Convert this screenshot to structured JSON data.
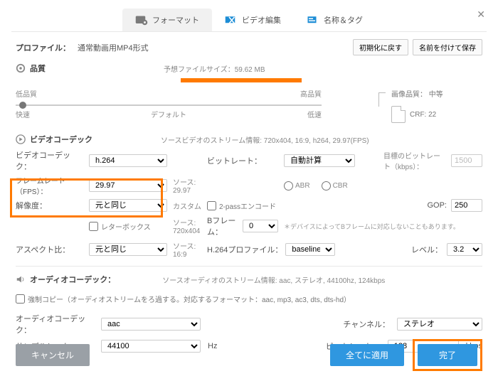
{
  "tabs": {
    "format": "フォーマット",
    "edit": "ビデオ編集",
    "tag": "名称＆タグ"
  },
  "profile": {
    "label": "プロファイル：",
    "value": "通常動画用MP4形式"
  },
  "buttons": {
    "reset": "初期化に戻す",
    "saveas": "名前を付けて保存",
    "cancel": "キャンセル",
    "apply": "全てに適用",
    "done": "完了"
  },
  "quality": {
    "title": "品質",
    "est_label": "予想ファイルサイズ：",
    "est_value": "59.62 MB",
    "low": "低品質",
    "high": "高品質",
    "fast": "快速",
    "default": "デフォルト",
    "slow": "低速",
    "pic_q_label": "画像品質：",
    "pic_q_value": "中等",
    "crf_label": "CRF:",
    "crf_value": "22"
  },
  "video": {
    "title": "ビデオコーデック",
    "stream": "ソースビデオのストリーム情報: 720x404, 16:9, h264, 29.97(FPS)",
    "codec_label": "ビデオコーデック：",
    "codec_value": "h.264",
    "bitrate_label": "ビットレート：",
    "bitrate_value": "自動計算",
    "target_label": "目標のビットレート（kbps）：",
    "target_value": "1500",
    "abr": "ABR",
    "cbr": "CBR",
    "fps_label": "フレームレート（FPS）：",
    "fps_value": "29.97",
    "src_prefix": "ソース:",
    "src_fps": "29.97",
    "twopass": "2-passエンコード",
    "gop_label": "GOP:",
    "gop_value": "250",
    "res_label": "解像度：",
    "res_value": "元と同じ",
    "res_note": "カスタム",
    "letterbox": "レターボックス",
    "src_res": "720x404",
    "bframe_label": "Bフレーム：",
    "bframe_value": "0",
    "bframe_note": "＊デバイスによってBフレームに対応しないこともあります。",
    "aspect_label": "アスペクト比：",
    "aspect_value": "元と同じ",
    "src_aspect": "16:9",
    "profile_label": "H.264プロファイル：",
    "profile_value": "baseline",
    "level_label": "レベル：",
    "level_value": "3.2"
  },
  "audio": {
    "title": "オーディオコーデック：",
    "stream": "ソースオーディオのストリーム情報: aac, ステレオ, 44100hz, 124kbps",
    "force": "強制コピー（オーディオストリームをろ過する。対応するフォーマット：aac, mp3, ac3, dts, dts-hd）",
    "codec_label": "オーディオコーデック：",
    "codec_value": "aac",
    "ch_label": "チャンネル：",
    "ch_value": "ステレオ",
    "rate_label": "サンプルレート：",
    "rate_value": "44100",
    "hz": "Hz",
    "abitrate_label": "ビットレート：",
    "abitrate_value": "128",
    "kbps": "kbps"
  }
}
